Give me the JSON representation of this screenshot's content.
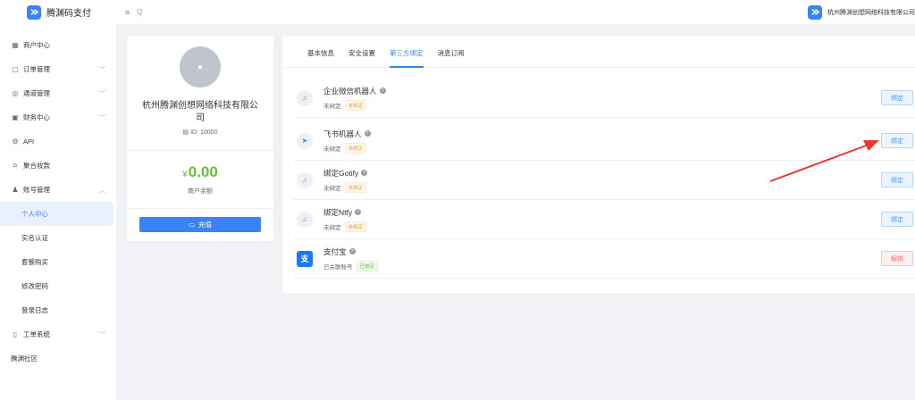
{
  "header": {
    "brand": "腾渊码支付",
    "menu_icon": "≡",
    "search_icon": "Q",
    "company": "杭州腾渊创想网络科技有限公司"
  },
  "sidebar": {
    "items": [
      {
        "label": "商户中心",
        "icon": "grid-icon"
      },
      {
        "label": "订单管理",
        "icon": "calendar-icon"
      },
      {
        "label": "通道管理",
        "icon": "settings-icon"
      },
      {
        "label": "财务中心",
        "icon": "wallet-icon"
      },
      {
        "label": "API",
        "icon": "api-icon"
      },
      {
        "label": "聚合收款",
        "icon": "money-icon"
      },
      {
        "label": "账号管理",
        "icon": "user-icon"
      },
      {
        "label": "个人中心"
      },
      {
        "label": "实名认证"
      },
      {
        "label": "套餐购买"
      },
      {
        "label": "修改密码"
      },
      {
        "label": "登录日志"
      },
      {
        "label": "工单系统",
        "icon": "book-icon"
      },
      {
        "label": "腾渊社区"
      }
    ]
  },
  "profile": {
    "company_name": "杭州腾渊创想网络科技有限公司",
    "id_text": "ID: 10000",
    "currency": "¥",
    "balance": "0.00",
    "balance_label": "商户余额",
    "recharge_label": "充值"
  },
  "tabs": [
    "基本信息",
    "安全设置",
    "第三方绑定",
    "消息订阅"
  ],
  "bindings": [
    {
      "name": "企业微信机器人",
      "status": "未绑定",
      "tag": "未绑定",
      "button": "绑定"
    },
    {
      "name": "飞书机器人",
      "status": "未绑定",
      "tag": "未绑定",
      "button": "绑定"
    },
    {
      "name": "绑定Gotify",
      "status": "未绑定",
      "tag": "未绑定",
      "button": "绑定"
    },
    {
      "name": "绑定Ntfy",
      "status": "未绑定",
      "tag": "未绑定",
      "button": "绑定"
    },
    {
      "name": "支付宝",
      "status": "已关联账号",
      "tag": "已绑定",
      "button": "解绑"
    }
  ],
  "colors": {
    "accent": "#3b82f6",
    "success": "#67c23a",
    "warning": "#e6a23c",
    "danger": "#f56c6c",
    "annotation_arrow": "#e8392d"
  }
}
